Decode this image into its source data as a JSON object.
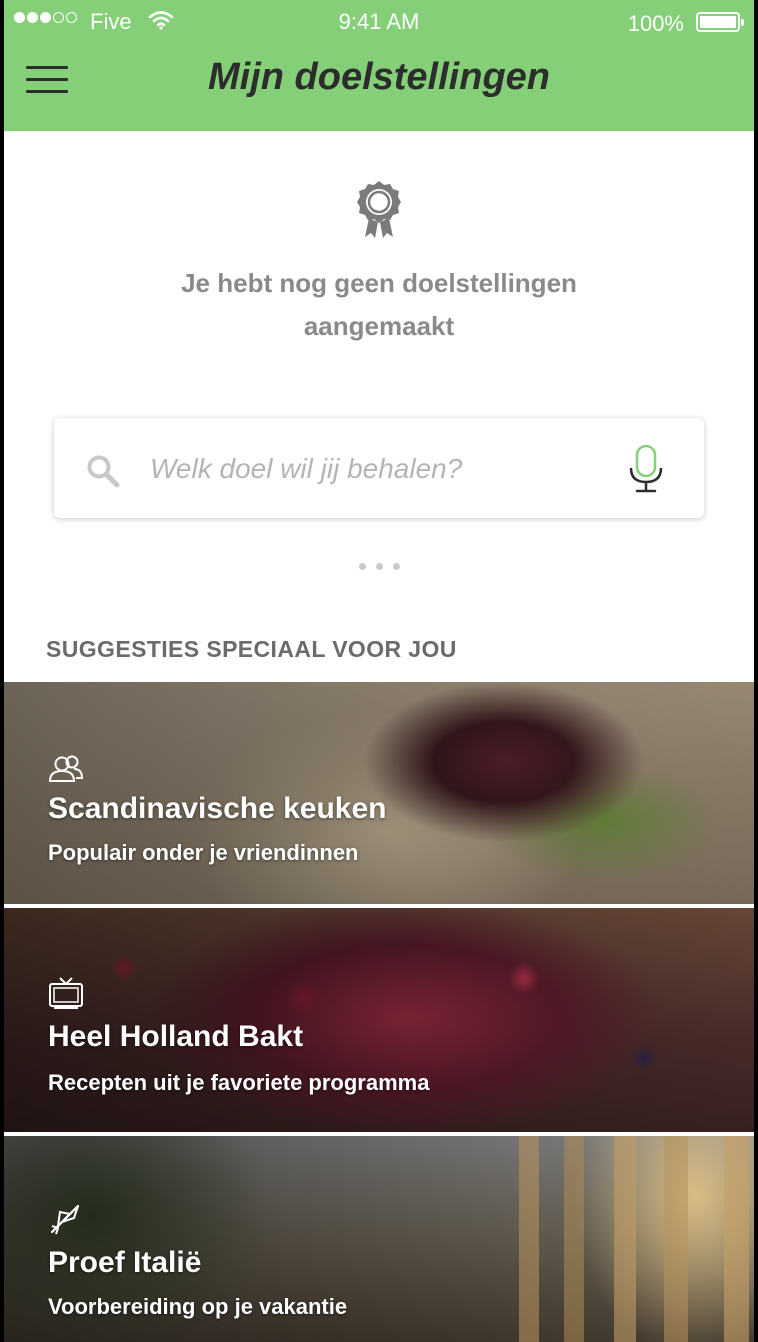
{
  "status_bar": {
    "carrier": "Five",
    "time": "9:41 AM",
    "battery": "100%"
  },
  "header": {
    "title": "Mijn doelstellingen"
  },
  "empty_state": {
    "message": "Je hebt nog geen doelstellingen aangemaakt"
  },
  "search": {
    "placeholder": "Welk doel wil jij behalen?"
  },
  "suggestions": {
    "section_title": "SUGGESTIES SPECIAAL VOOR JOU",
    "items": [
      {
        "icon": "friends-icon",
        "title": "Scandinavische keuken",
        "subtitle": "Populair onder je vriendinnen"
      },
      {
        "icon": "tv-icon",
        "title": "Heel Holland Bakt",
        "subtitle": "Recepten uit je favoriete programma"
      },
      {
        "icon": "airplane-icon",
        "title": "Proef Italië",
        "subtitle": "Voorbereiding op je vakantie"
      }
    ]
  },
  "colors": {
    "header": "#84cf78",
    "mic_accent": "#84cf78",
    "muted_text": "#8a8a8a"
  }
}
